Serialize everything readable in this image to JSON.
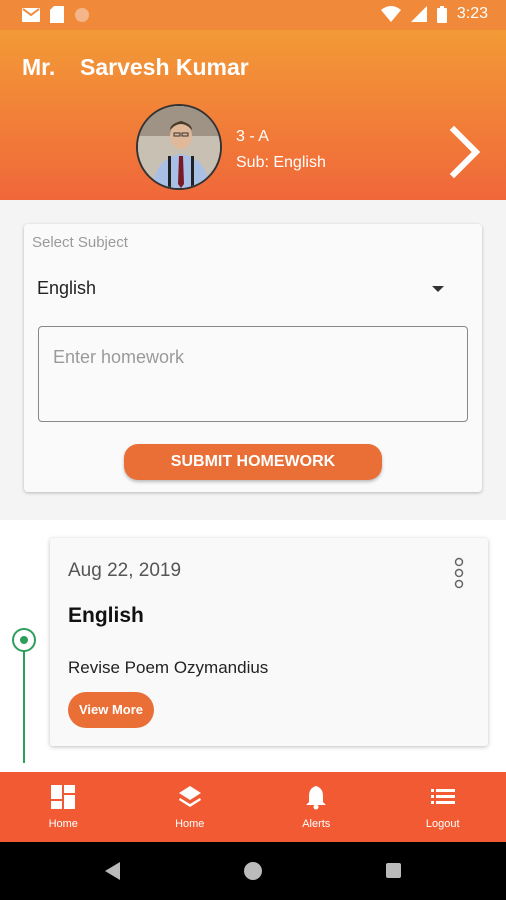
{
  "status_bar": {
    "time": "3:23",
    "left_icons": [
      "mail-icon",
      "sd-card-icon",
      "circle-icon"
    ],
    "right_icons": [
      "wifi-icon",
      "signal-icon",
      "battery-icon"
    ]
  },
  "header": {
    "salutation": "Mr.",
    "teacher_name": "Sarvesh Kumar",
    "class_section": "3 - A",
    "subject": "Sub: English"
  },
  "form": {
    "select_label": "Select Subject",
    "selected_subject": "English",
    "homework_placeholder": "Enter homework",
    "homework_value": "",
    "submit_label": "SUBMIT HOMEWORK"
  },
  "homework_list": [
    {
      "date": "Aug 22, 2019",
      "subject": "English",
      "description": "Revise Poem Ozymandius",
      "view_more_label": "View More"
    }
  ],
  "bottom_nav": [
    {
      "label": "Home",
      "icon": "dashboard-icon"
    },
    {
      "label": "Home",
      "icon": "layers-icon"
    },
    {
      "label": "Alerts",
      "icon": "bell-icon"
    },
    {
      "label": "Logout",
      "icon": "list-icon"
    }
  ],
  "colors": {
    "header_top": "#f39a36",
    "header_bottom": "#f0673a",
    "accent": "#ea6f36",
    "nav_bar": "#f15a33",
    "timeline": "#2e9e5b"
  }
}
